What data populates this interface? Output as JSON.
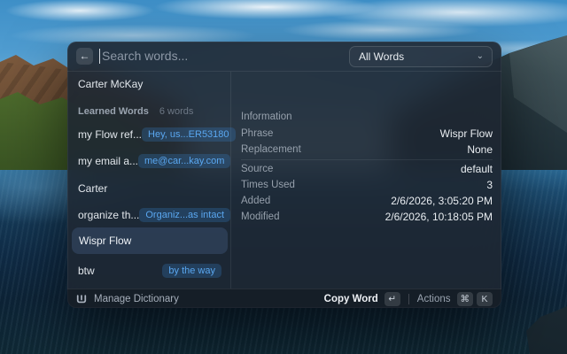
{
  "search": {
    "back_icon": "←",
    "placeholder": "Search words..."
  },
  "filter": {
    "value": "All Words",
    "chevron": "⌄"
  },
  "sidebar": {
    "top_item": "Carter McKay",
    "section": {
      "label": "Learned Words",
      "count": "6 words"
    },
    "items": [
      {
        "label": "my Flow ref...",
        "badge": "Hey, us...ER53180"
      },
      {
        "label": "my email a...",
        "badge": "me@car...kay.com"
      },
      {
        "label": "Carter",
        "badge": ""
      },
      {
        "label": "organize th...",
        "badge": "Organiz...as intact"
      },
      {
        "label": "Wispr Flow",
        "badge": "",
        "selected": true
      },
      {
        "label": "btw",
        "badge": "by the way"
      }
    ]
  },
  "details": {
    "header": "Information",
    "rows_top": [
      {
        "label": "Phrase",
        "value": "Wispr Flow"
      },
      {
        "label": "Replacement",
        "value": "None"
      }
    ],
    "rows_bottom": [
      {
        "label": "Source",
        "value": "default"
      },
      {
        "label": "Times Used",
        "value": "3"
      },
      {
        "label": "Added",
        "value": "2/6/2026, 3:05:20 PM"
      },
      {
        "label": "Modified",
        "value": "2/6/2026, 10:18:05 PM"
      }
    ]
  },
  "footer": {
    "manage_label": "Manage Dictionary",
    "copy_label": "Copy Word",
    "enter_key": "↵",
    "actions_label": "Actions",
    "cmd_key": "⌘",
    "k_key": "K"
  },
  "colors": {
    "accent_blue": "#5aa7f0",
    "badge_bg": "#2a4f76",
    "panel_bg": "#1e2732",
    "selected_row": "#3c4f6d"
  }
}
